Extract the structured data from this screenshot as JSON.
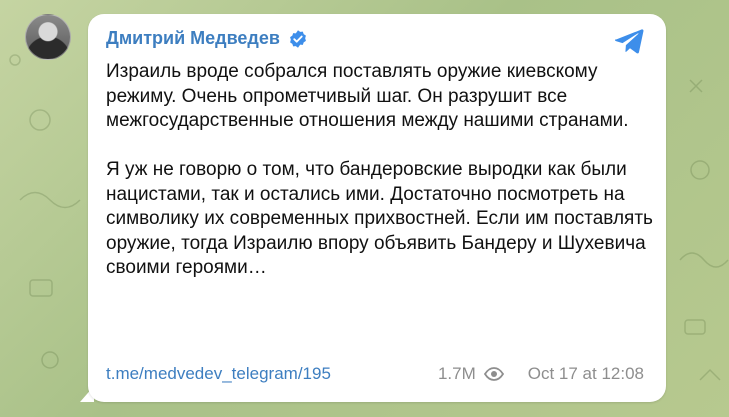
{
  "post": {
    "author": "Дмитрий Медведев",
    "paragraphs": [
      "Израиль вроде собрался поставлять оружие киевскому режиму. Очень опрометчивый шаг. Он разрушит все межгосударственные отношения между нашими странами.",
      "Я уж не говорю о том, что бандеровские выродки как были нацистами, так и остались ими. Достаточно посмотреть на символику их современных прихвостней. Если им поставлять оружие, тогда Израилю впору объявить Бандеру и Шухевича своими героями…"
    ],
    "link": "t.me/medvedev_telegram/195",
    "views": "1.7M",
    "timestamp": "Oct 17 at 12:08"
  },
  "icons": {
    "verified": "verified-badge-icon",
    "share": "telegram-share-icon",
    "views": "eye-icon"
  },
  "colors": {
    "accent": "#3d7ec0",
    "meta": "#8e8e8e",
    "background": "#b0c68c"
  }
}
